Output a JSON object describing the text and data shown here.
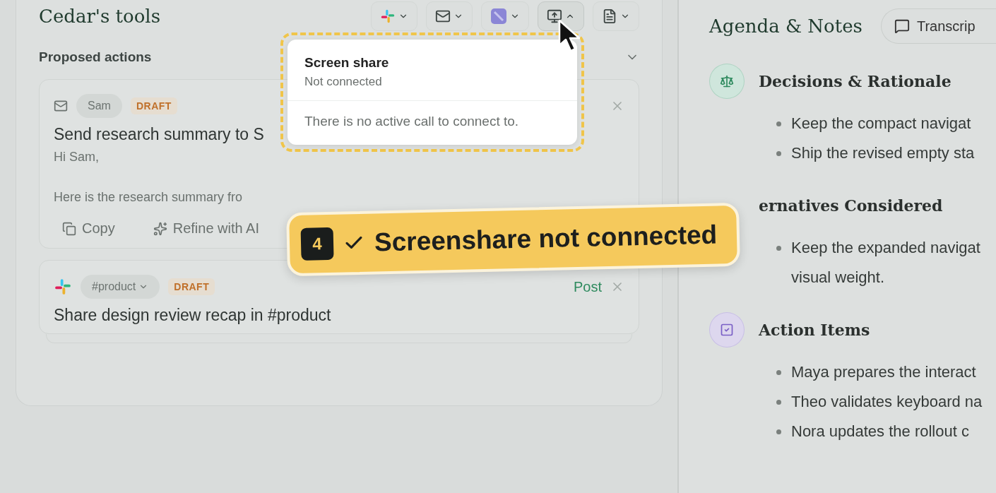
{
  "tools_panel": {
    "title": "Cedar's tools",
    "toolbar": [
      {
        "kind": "slack",
        "expanded": false
      },
      {
        "kind": "mail",
        "expanded": false
      },
      {
        "kind": "app",
        "expanded": false
      },
      {
        "kind": "screen",
        "expanded": true
      },
      {
        "kind": "doc",
        "expanded": false
      }
    ],
    "section_title": "Proposed actions",
    "actions": [
      {
        "kind": "email",
        "recipient": "Sam",
        "badge": "DRAFT",
        "title": "Send research summary to S",
        "body": [
          "Hi Sam,",
          "Here is the research summary fro"
        ],
        "buttons": [
          {
            "kind": "copy",
            "label": "Copy"
          },
          {
            "kind": "refine",
            "label": "Refine with AI"
          }
        ]
      },
      {
        "kind": "slack",
        "recipient": "#product",
        "badge": "DRAFT",
        "primary": "Post",
        "title": "Share design review recap in #product"
      }
    ]
  },
  "notes_panel": {
    "title": "Agenda & Notes",
    "transcript_button": "Transcrip",
    "sections": [
      {
        "kind": "decisions",
        "title": "Decisions & Rationale",
        "items": [
          "Keep the compact navigat",
          "Ship the revised empty sta"
        ]
      },
      {
        "kind": "hidden",
        "title": "ernatives Considered",
        "items": [
          "Keep the expanded navigat\nvisual weight."
        ]
      },
      {
        "kind": "actions",
        "title": "Action Items",
        "items": [
          "Maya prepares the interact",
          "Theo validates keyboard na",
          "Nora updates the rollout c"
        ]
      }
    ]
  },
  "popover": {
    "title": "Screen share",
    "status": "Not connected",
    "message": "There is no active call to connect to."
  },
  "toast": {
    "step": "4",
    "text": "Screenshare not connected"
  }
}
